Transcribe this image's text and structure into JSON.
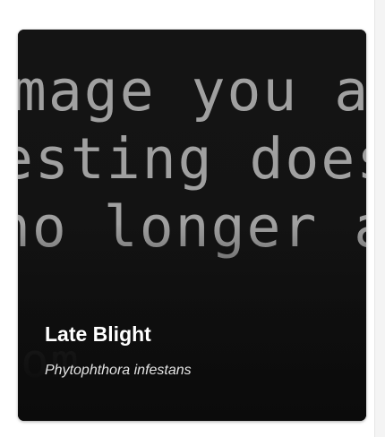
{
  "card": {
    "title": "Late Blight",
    "subtitle": "Phytophthora infestans",
    "image_lines": [
      "image you are",
      "esting does no",
      "no longer avai",
      "com"
    ]
  }
}
